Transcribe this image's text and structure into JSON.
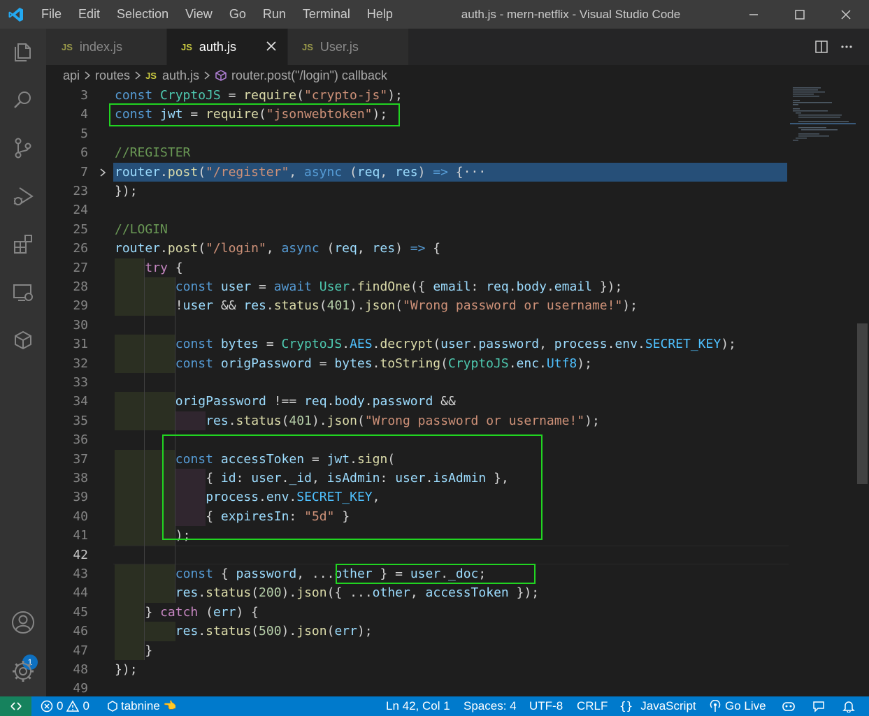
{
  "window": {
    "title": "auth.js - mern-netflix - Visual Studio Code"
  },
  "menu": [
    "File",
    "Edit",
    "Selection",
    "View",
    "Go",
    "Run",
    "Terminal",
    "Help"
  ],
  "tabs": [
    {
      "badge": "JS",
      "label": "index.js",
      "active": false
    },
    {
      "badge": "JS",
      "label": "auth.js",
      "active": true
    },
    {
      "badge": "JS",
      "label": "User.js",
      "active": false
    }
  ],
  "breadcrumb": {
    "parts": [
      "api",
      "routes"
    ],
    "file_badge": "JS",
    "file": "auth.js",
    "symbol": "router.post(\"/login\") callback"
  },
  "activity": {
    "accounts_badge": "1"
  },
  "editor": {
    "lines": [
      {
        "n": "3",
        "text": "const CryptoJS = require(\"crypto-js\");"
      },
      {
        "n": "4",
        "text": "const jwt = require(\"jsonwebtoken\");"
      },
      {
        "n": "5",
        "text": ""
      },
      {
        "n": "6",
        "text": "//REGISTER"
      },
      {
        "n": "7",
        "text": "router.post(\"/register\", async (req, res) => {···"
      },
      {
        "n": "23",
        "text": "});"
      },
      {
        "n": "24",
        "text": ""
      },
      {
        "n": "25",
        "text": "//LOGIN"
      },
      {
        "n": "26",
        "text": "router.post(\"/login\", async (req, res) => {"
      },
      {
        "n": "27",
        "text": "try {"
      },
      {
        "n": "28",
        "text": "const user = await User.findOne({ email: req.body.email });"
      },
      {
        "n": "29",
        "text": "!user && res.status(401).json(\"Wrong password or username!\");"
      },
      {
        "n": "30",
        "text": ""
      },
      {
        "n": "31",
        "text": "const bytes = CryptoJS.AES.decrypt(user.password, process.env.SECRET_KEY);"
      },
      {
        "n": "32",
        "text": "const origPassword = bytes.toString(CryptoJS.enc.Utf8);"
      },
      {
        "n": "33",
        "text": ""
      },
      {
        "n": "34",
        "text": "origPassword !== req.body.password &&"
      },
      {
        "n": "35",
        "text": "res.status(401).json(\"Wrong password or username!\");"
      },
      {
        "n": "36",
        "text": ""
      },
      {
        "n": "37",
        "text": "const accessToken = jwt.sign("
      },
      {
        "n": "38",
        "text": "{ id: user._id, isAdmin: user.isAdmin },"
      },
      {
        "n": "39",
        "text": "process.env.SECRET_KEY,"
      },
      {
        "n": "40",
        "text": "{ expiresIn: \"5d\" }"
      },
      {
        "n": "41",
        "text": ");"
      },
      {
        "n": "42",
        "text": ""
      },
      {
        "n": "43",
        "text": "const { password, ...other } = user._doc;"
      },
      {
        "n": "44",
        "text": "res.status(200).json({ ...other, accessToken });"
      },
      {
        "n": "45",
        "text": "} catch (err) {"
      },
      {
        "n": "46",
        "text": "res.status(500).json(err);"
      },
      {
        "n": "47",
        "text": "}"
      },
      {
        "n": "48",
        "text": "});"
      },
      {
        "n": "49",
        "text": ""
      }
    ],
    "current_line": "42"
  },
  "status": {
    "errors": "0",
    "warnings": "0",
    "tabnine": "tabnine",
    "position": "Ln 42, Col 1",
    "spaces": "Spaces: 4",
    "encoding": "UTF-8",
    "eol": "CRLF",
    "language": "JavaScript",
    "golive": "Go Live"
  },
  "colors": {
    "highlight_box": "#21d421",
    "statusbar": "#007acc",
    "activitybar": "#333333",
    "editor_bg": "#1e1e1e"
  }
}
